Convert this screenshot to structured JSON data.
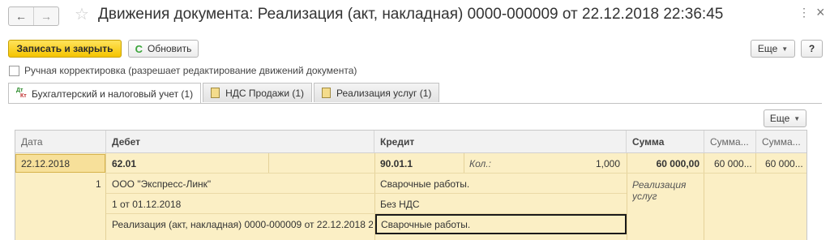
{
  "window": {
    "title": "Движения документа: Реализация (акт, накладная) 0000-000009 от 22.12.2018 22:36:45",
    "back_glyph": "←",
    "forward_glyph": "→",
    "star_glyph": "☆",
    "menu_glyph": "⋮",
    "close_glyph": "×"
  },
  "toolbar": {
    "save_close_label": "Записать и закрыть",
    "refresh_label": "Обновить",
    "more_label": "Еще",
    "help_label": "?"
  },
  "manual_edit": {
    "label": "Ручная корректировка (разрешает редактирование движений документа)",
    "checked": false
  },
  "tabs": [
    {
      "label": "Бухгалтерский и налоговый учет (1)",
      "active": true,
      "icon": "dt-kt-icon"
    },
    {
      "label": "НДС Продажи (1)",
      "active": false,
      "icon": "register-icon"
    },
    {
      "label": "Реализация услуг (1)",
      "active": false,
      "icon": "register-icon"
    }
  ],
  "grid_toolbar": {
    "more_label": "Еще"
  },
  "grid": {
    "columns": {
      "date": "Дата",
      "debit": "Дебет",
      "credit": "Кредит",
      "sum": "Сумма",
      "sum_dt": "Сумма...",
      "sum_kt": "Сумма..."
    },
    "row": {
      "date": "22.12.2018",
      "line_no": "1",
      "debit_account": "62.01",
      "debit_subconto1": "ООО \"Экспресс-Линк\"",
      "debit_subconto2": "1 от 01.12.2018",
      "debit_subconto3": "Реализация (акт, накладная) 0000-000009 от 22.12.2018 2...",
      "credit_account": "90.01.1",
      "qty_label": "Кол.:",
      "qty_value": "1,000",
      "credit_subconto1": "Сварочные работы.",
      "credit_subconto2": "Без НДС",
      "credit_subconto3": "Сварочные работы.",
      "sum": "60 000,00",
      "sum_dt": "60 000...",
      "sum_kt": "60 000...",
      "content": "Реализация услуг"
    }
  }
}
